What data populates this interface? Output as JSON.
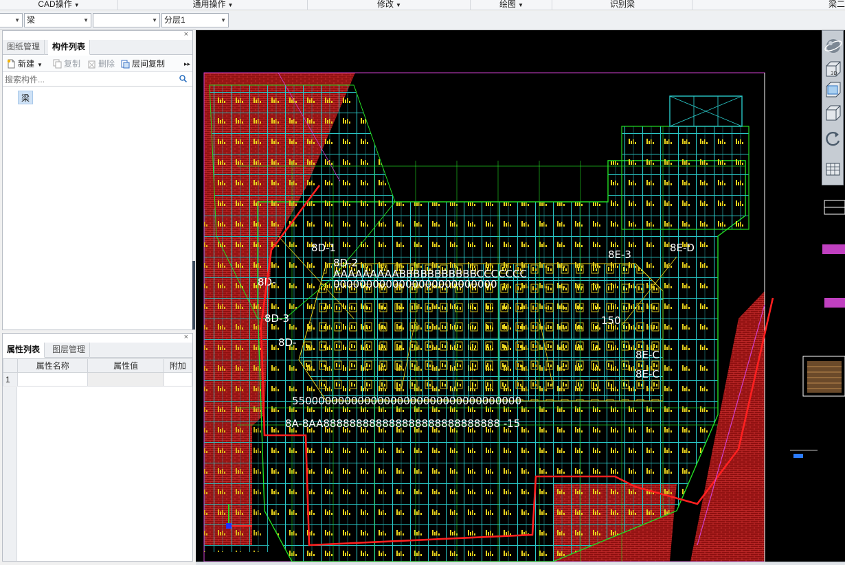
{
  "ribbon": {
    "groups": [
      {
        "label": "CAD操作",
        "has_dropdown": true
      },
      {
        "label": "通用操作",
        "has_dropdown": true
      },
      {
        "label": "修改",
        "has_dropdown": true
      },
      {
        "label": "绘图",
        "has_dropdown": true
      },
      {
        "label": "识别梁",
        "has_dropdown": false
      },
      {
        "label": "梁二",
        "has_dropdown": false
      }
    ]
  },
  "selectors": {
    "first": {
      "value": ""
    },
    "component_type": {
      "value": "梁"
    },
    "component_name": {
      "value": ""
    },
    "layer": {
      "value": "分层1"
    }
  },
  "component_panel": {
    "tabs": [
      "图纸管理",
      "构件列表"
    ],
    "active_tab": "构件列表",
    "toolbar": {
      "new_label": "新建",
      "copy_label": "复制",
      "delete_label": "删除",
      "floor_copy_label": "层间复制",
      "more_icon": "double-chevron-right-icon"
    },
    "search": {
      "placeholder": "搜索构件..."
    },
    "tree_items": [
      "梁"
    ]
  },
  "property_panel": {
    "tabs": [
      "属性列表",
      "图层管理"
    ],
    "active_tab": "属性列表",
    "columns": [
      "属性名称",
      "属性值",
      "附加"
    ],
    "rows": [
      {
        "index": "1",
        "name": "",
        "value": "",
        "extra": ""
      }
    ]
  },
  "close_icon": "×",
  "view_tools": [
    "orbit-sphere-icon",
    "3d-view-icon",
    "box-view-icon",
    "cube-view-icon",
    "rotate-icon",
    "layer-grid-icon"
  ],
  "colors": {
    "canvas_bg": "#000000",
    "grid_cyan": "#29c7c7",
    "axis_green": "#22dd22",
    "annotation_yellow": "#e8d21c",
    "brick_red": "#9b1111",
    "boundary_red": "#ff2020",
    "border_magenta": "#d040d0"
  }
}
